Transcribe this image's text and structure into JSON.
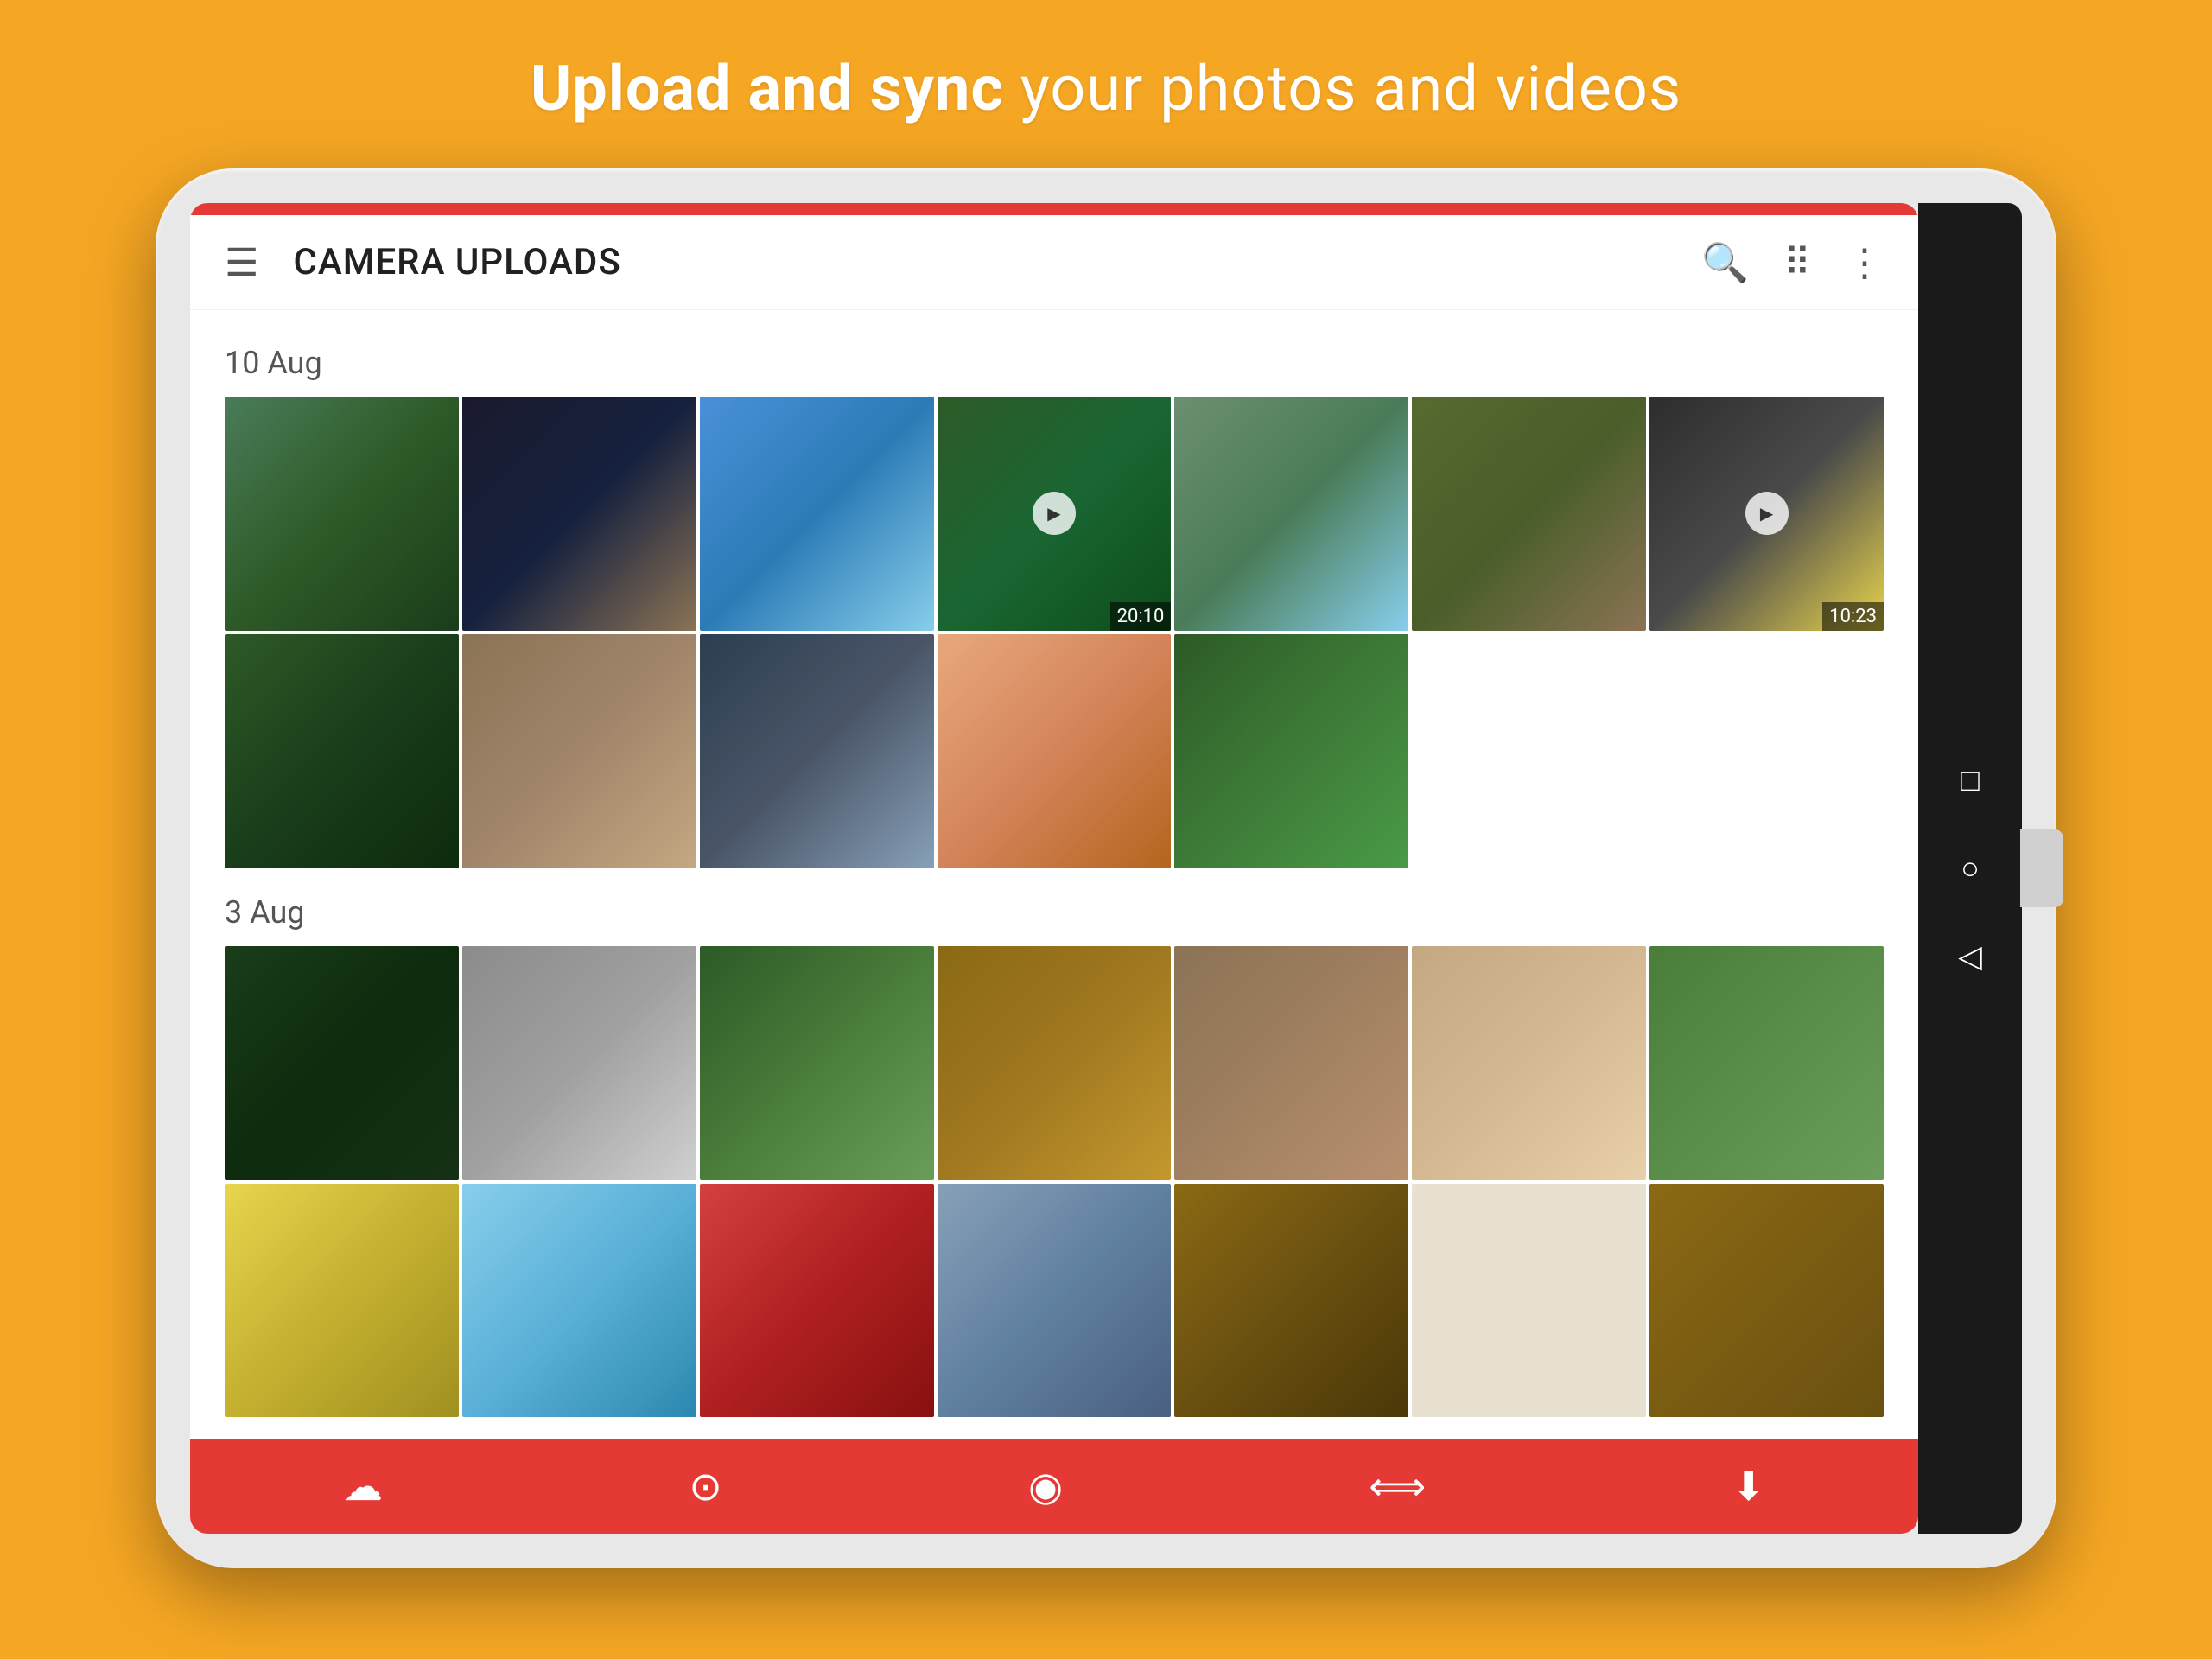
{
  "headline": {
    "prefix": "Upload and sync",
    "suffix": " your photos and videos"
  },
  "appbar": {
    "title": "CAMERA UPLOADS"
  },
  "sections": [
    {
      "date": "10 Aug",
      "rows": [
        [
          {
            "color": "c1",
            "type": "photo"
          },
          {
            "color": "c2",
            "type": "photo"
          },
          {
            "color": "c3",
            "type": "photo"
          },
          {
            "color": "c4",
            "type": "video",
            "duration": "20:10"
          },
          {
            "color": "c5",
            "type": "photo"
          },
          {
            "color": "c6",
            "type": "photo"
          },
          {
            "color": "c7",
            "type": "video",
            "duration": "10:23"
          }
        ],
        [
          {
            "color": "c8",
            "type": "photo"
          },
          {
            "color": "c9",
            "type": "photo"
          },
          {
            "color": "c10",
            "type": "photo"
          },
          {
            "color": "c11",
            "type": "photo"
          },
          {
            "color": "c12",
            "type": "photo"
          },
          {
            "color": "c14",
            "type": "empty"
          },
          {
            "color": "c14",
            "type": "empty"
          }
        ]
      ]
    },
    {
      "date": "3 Aug",
      "rows": [
        [
          {
            "color": "c15",
            "type": "photo"
          },
          {
            "color": "c16",
            "type": "photo"
          },
          {
            "color": "c17",
            "type": "photo"
          },
          {
            "color": "c18",
            "type": "photo"
          },
          {
            "color": "c19",
            "type": "photo"
          },
          {
            "color": "c20",
            "type": "photo"
          },
          {
            "color": "c21",
            "type": "photo"
          }
        ],
        [
          {
            "color": "c22",
            "type": "photo"
          },
          {
            "color": "c23",
            "type": "photo"
          },
          {
            "color": "c24",
            "type": "photo"
          },
          {
            "color": "c25",
            "type": "photo"
          },
          {
            "color": "c26",
            "type": "photo"
          },
          {
            "color": "c14",
            "type": "empty"
          },
          {
            "color": "c26",
            "type": "photo"
          }
        ]
      ]
    }
  ],
  "bottomBar": {
    "icons": [
      "cloud-icon",
      "camera-icon",
      "chat-icon",
      "sync-icon",
      "download-icon"
    ]
  },
  "androidNav": {
    "buttons": [
      "square-icon",
      "circle-icon",
      "triangle-icon"
    ]
  }
}
